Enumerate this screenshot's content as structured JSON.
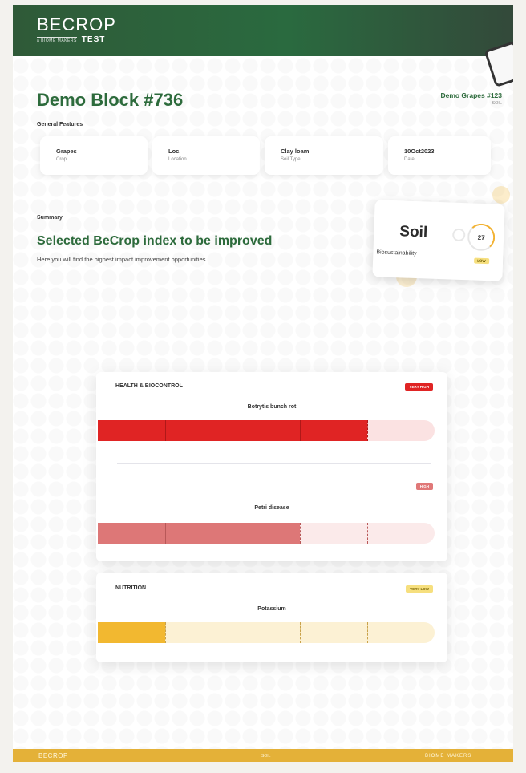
{
  "header": {
    "logo_main": "BECROP",
    "logo_tag": "a BIOME MAKERS",
    "logo_test": "TEST"
  },
  "page_title": "Demo Block #736",
  "sample": {
    "name": "Demo Grapes #123",
    "sub": "SOIL"
  },
  "general_features_label": "General Features",
  "features": [
    {
      "value": "Grapes",
      "label": "Crop"
    },
    {
      "value": "Loc.",
      "label": "Location"
    },
    {
      "value": "Clay loam",
      "label": "Soil Type"
    },
    {
      "value": "10Oct2023",
      "label": "Date"
    }
  ],
  "summary": {
    "label": "Summary",
    "title": "Selected BeCrop index to be improved",
    "description": "Here you will find the highest impact improvement opportunities."
  },
  "soil_card": {
    "title": "Soil",
    "subtitle": "Biosustainability",
    "score": "27",
    "badge": "LOW"
  },
  "health_card": {
    "heading": "HEALTH & BIOCONTROL",
    "items": [
      {
        "badge": "VERY HIGH",
        "name": "Botrytis bunch rot",
        "level": 0.8
      },
      {
        "badge": "HIGH",
        "name": "Petri disease",
        "level": 0.6
      }
    ]
  },
  "nutrition_card": {
    "heading": "NUTRITION",
    "items": [
      {
        "badge": "VERY LOW",
        "name": "Potassium",
        "level": 0.2
      }
    ]
  },
  "footer": {
    "left": "BECROP",
    "center": "SOIL",
    "right": "BIOME MAKERS"
  },
  "colors": {
    "brand_green": "#2d6b3c",
    "very_high": "#e02424",
    "high": "#e07878",
    "very_low": "#f2b830",
    "footer": "#e4b138"
  }
}
